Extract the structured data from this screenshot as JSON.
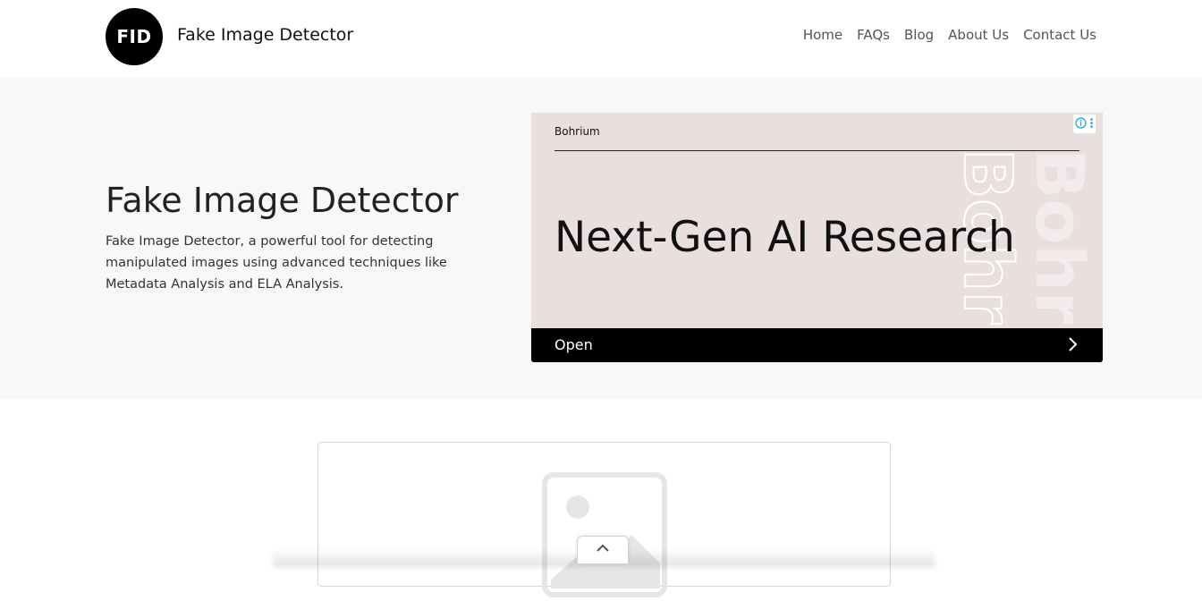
{
  "header": {
    "logo_text": "FID",
    "site_title": "Fake Image Detector",
    "nav": [
      {
        "label": "Home"
      },
      {
        "label": "FAQs"
      },
      {
        "label": "Blog"
      },
      {
        "label": "About Us"
      },
      {
        "label": "Contact Us"
      }
    ]
  },
  "hero": {
    "title": "Fake Image Detector",
    "description": "Fake Image Detector, a powerful tool for detecting manipulated images using advanced techniques like Metadata Analysis and ELA Analysis."
  },
  "ad": {
    "brand": "Bohrium",
    "headline": "Next-Gen AI Research",
    "cta_label": "Open",
    "watermark_text": "Bohrium",
    "icons": [
      "info-icon",
      "more-vertical-icon",
      "chevron-right-icon"
    ],
    "background_color": "#e9dfdf"
  },
  "upload": {
    "placeholder_icon": "image-placeholder-icon",
    "scroll_icon": "chevron-up-icon"
  },
  "colors": {
    "hero_background": "#f6f8f9",
    "logo_background": "#000000",
    "nav_text": "#555555"
  }
}
